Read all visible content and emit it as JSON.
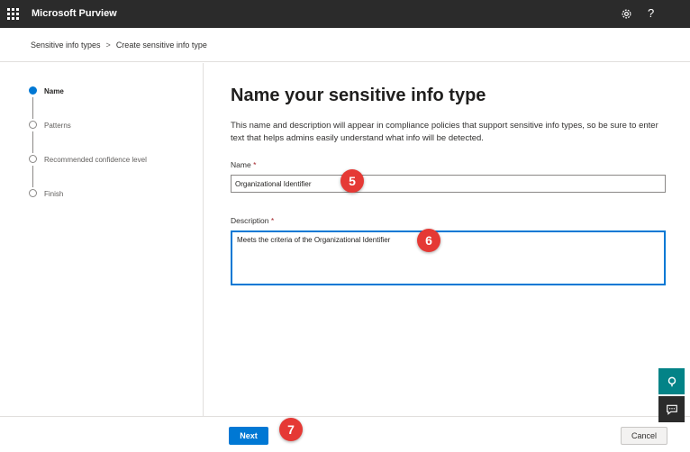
{
  "app": {
    "title": "Microsoft Purview",
    "help_glyph": "?"
  },
  "breadcrumb": {
    "items": [
      "Sensitive info types",
      "Create sensitive info type"
    ],
    "separator": ">"
  },
  "steps": [
    {
      "label": "Name",
      "active": true
    },
    {
      "label": "Patterns",
      "active": false
    },
    {
      "label": "Recommended confidence level",
      "active": false
    },
    {
      "label": "Finish",
      "active": false
    }
  ],
  "main": {
    "title": "Name your sensitive info type",
    "description": "This name and description will appear in compliance policies that support sensitive info types, so be sure to enter text that helps admins easily understand what info will be detected.",
    "name_label": "Name",
    "name_value": "Organizational Identifier",
    "description_label": "Description",
    "description_value": "Meets the criteria of the Organizational Identifier",
    "required_mark": "*"
  },
  "markers": [
    "5",
    "6",
    "7"
  ],
  "footer": {
    "next_label": "Next",
    "cancel_label": "Cancel"
  },
  "colors": {
    "accent": "#0078d4",
    "topbar": "#2b2b2b",
    "marker": "#e53935",
    "help_widget": "#038387"
  }
}
